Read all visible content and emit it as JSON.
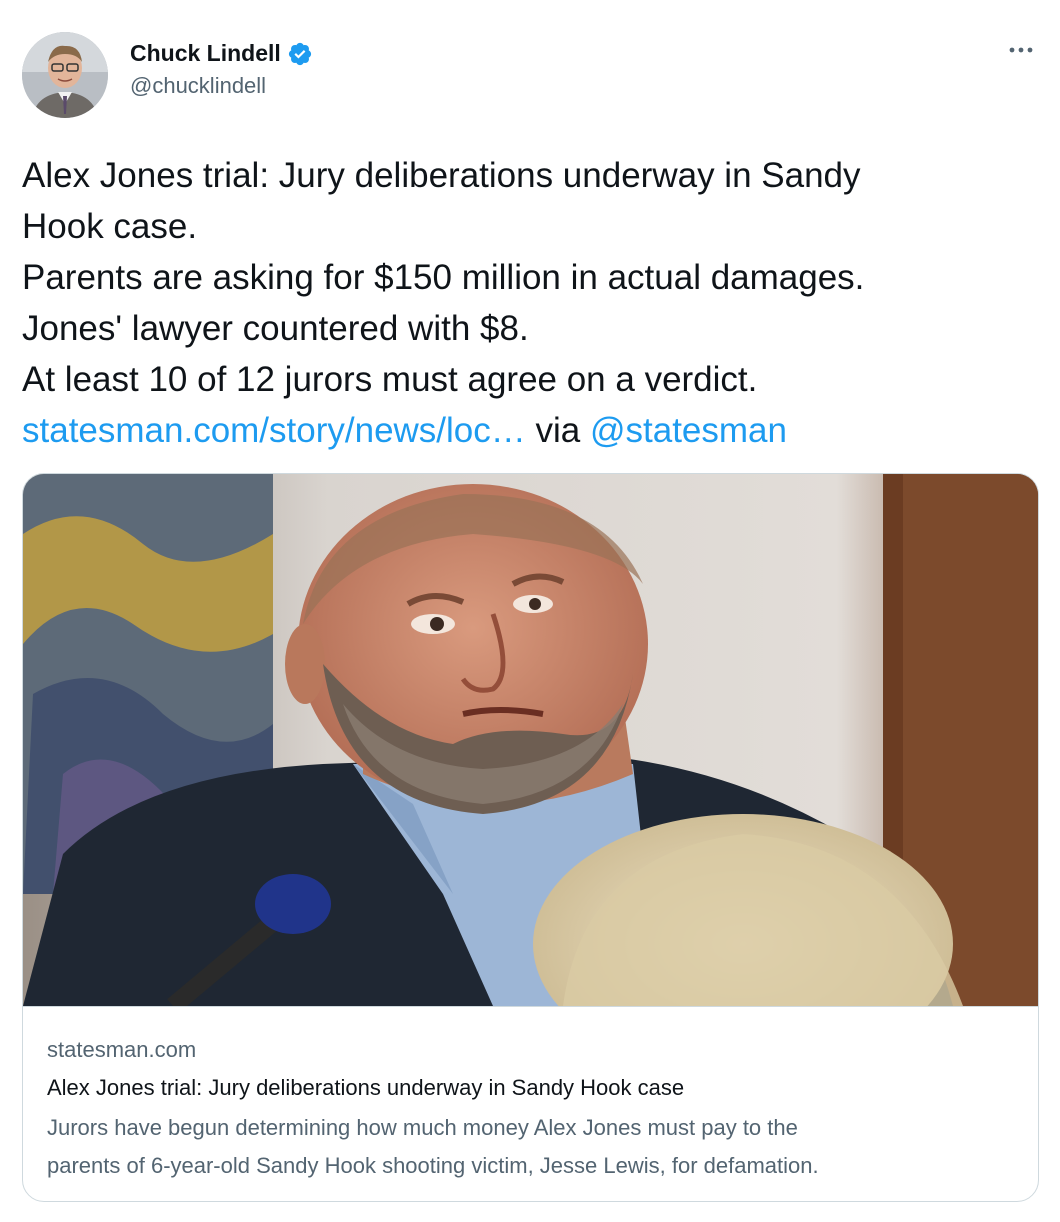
{
  "author": {
    "name": "Chuck Lindell",
    "handle": "@chucklindell",
    "verified_icon": "verified-badge-icon",
    "avatar_icon": "avatar-photo"
  },
  "more_icon": "more-options-icon",
  "tweet": {
    "lines": [
      "Alex Jones trial: Jury deliberations underway in Sandy",
      "Hook case.",
      "Parents are asking for $150 million in actual damages.",
      "Jones' lawyer countered with $8.",
      "At least 10 of 12 jurors must agree on a verdict."
    ],
    "link_text": "statesman.com/story/news/loc…",
    "via_text": " via ",
    "mention": "@statesman"
  },
  "card": {
    "domain": "statesman.com",
    "title": "Alex Jones trial: Jury deliberations underway in Sandy Hook case",
    "description_line1": "Jurors have begun determining how much money Alex Jones must pay to the",
    "description_line2": "parents of 6-year-old Sandy Hook shooting victim, Jesse Lewis, for defamation."
  },
  "colors": {
    "text": "#0f1419",
    "secondary": "#536471",
    "link": "#1d9bf0",
    "border": "#cfd9de"
  }
}
